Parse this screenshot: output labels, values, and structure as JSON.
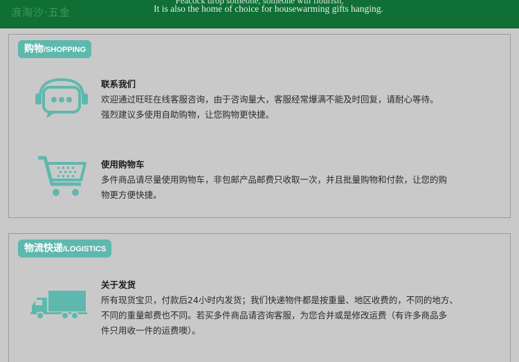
{
  "banner": {
    "brand": "浪淘沙·五金",
    "line1": "Peacock drop someone, someone will flourish,",
    "line2": "It is also the home of choice for housewarming gifts hanging."
  },
  "sections": {
    "shopping": {
      "tag_cn": "购物",
      "tag_en": "/SHOPPING",
      "items": [
        {
          "icon": "headset-chat-icon",
          "title": "联系我们",
          "lines": [
            "欢迎通过旺旺在线客服咨询，由于咨询量大，客服经常爆满不能及时回复，请耐心等待。",
            "强烈建议多使用自助购物，让您购物更快捷。"
          ]
        },
        {
          "icon": "shopping-cart-icon",
          "title": "使用购物车",
          "lines": [
            "多件商品请尽量使用购物车，非包邮产品邮费只收取一次，并且批量购物和付款，让您的购",
            "物更方便快捷。"
          ]
        }
      ]
    },
    "logistics": {
      "tag_cn": "物流快递",
      "tag_en": "/LOGISTICS",
      "items": [
        {
          "icon": "delivery-truck-icon",
          "title": "关于发货",
          "lines": [
            "所有现货宝贝，付款后24小时内发货；我们快递物件都是按重量、地区收费的，不同的地方、",
            "不同的重量邮费也不同。若买多件商品请咨询客服，为您合并或是修改运费（有许多商品多",
            "件只用收一件的运费噢）。"
          ]
        }
      ]
    }
  },
  "colors": {
    "banner": "#0f6f35",
    "accent": "#5fb8ad",
    "background": "#c9c9c9"
  }
}
